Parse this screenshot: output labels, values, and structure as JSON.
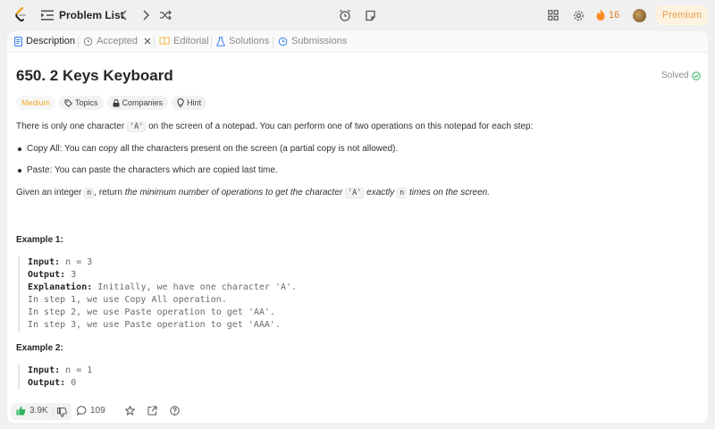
{
  "header": {
    "problem_list_label": "Problem List",
    "streak_count": "16",
    "premium_label": "Premium"
  },
  "tabs": [
    {
      "label": "Description",
      "active": true
    },
    {
      "label": "Accepted",
      "closable": true
    },
    {
      "label": "Editorial"
    },
    {
      "label": "Solutions"
    },
    {
      "label": "Submissions"
    }
  ],
  "problem": {
    "title": "650. 2 Keys Keyboard",
    "status": "Solved",
    "difficulty": "Medium",
    "chips": {
      "topics": "Topics",
      "companies": "Companies",
      "hint": "Hint"
    },
    "intro_1": "There is only one character",
    "intro_code": "'A'",
    "intro_2": "on the screen of a notepad. You can perform one of two operations on this notepad for each step:",
    "bullets": [
      "Copy All: You can copy all the characters present on the screen (a partial copy is not allowed).",
      "Paste: You can paste the characters which are copied last time."
    ],
    "given_1": "Given an integer",
    "given_n": "n",
    "given_2": ", return",
    "given_3": "the minimum number of operations to get the character",
    "given_code": "'A'",
    "given_4": "exactly",
    "given_n2": "n",
    "given_5": "times on the screen."
  },
  "examples": [
    {
      "title": "Example 1:",
      "input_label": "Input:",
      "input_value": "n = 3",
      "output_label": "Output:",
      "output_value": "3",
      "explanation_label": "Explanation:",
      "explanation_lines": [
        "Initially, we have one character 'A'.",
        "In step 1, we use Copy All operation.",
        "In step 2, we use Paste operation to get 'AA'.",
        "In step 3, we use Paste operation to get 'AAA'."
      ]
    },
    {
      "title": "Example 2:",
      "input_label": "Input:",
      "input_value": "n = 1",
      "output_label": "Output:",
      "output_value": "0"
    }
  ],
  "footer": {
    "likes": "3.9K",
    "comments": "109"
  },
  "colors": {
    "accent_orange": "#ffa116",
    "like_green": "#2db55d",
    "solved_green": "#2db55d",
    "tab_description_blue": "#3b82f6",
    "tab_editorial_yellow": "#f5b942",
    "tab_solutions_blue": "#3b82f6"
  }
}
